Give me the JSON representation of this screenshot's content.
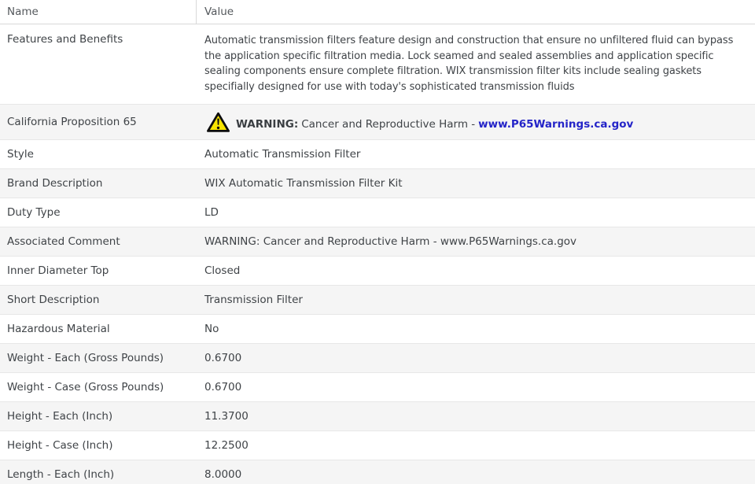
{
  "header": {
    "name_label": "Name",
    "value_label": "Value"
  },
  "prop65": {
    "icon": "warning-triangle-icon",
    "warning_label": "WARNING:",
    "text": "Cancer and Reproductive Harm -",
    "link_text": "www.P65Warnings.ca.gov"
  },
  "rows": [
    {
      "name": "Features and Benefits",
      "value": "Automatic transmission filters feature design and construction that ensure no unfiltered fluid can bypass the application specific filtration media. Lock seamed and sealed assemblies and application specific sealing components ensure complete filtration. WIX transmission filter kits include sealing gaskets specifially designed for use with today's sophisticated transmission fluids"
    },
    {
      "name": "California Proposition 65",
      "value": "WARNING: Cancer and Reproductive Harm - www.P65Warnings.ca.gov"
    },
    {
      "name": "Style",
      "value": "Automatic Transmission Filter"
    },
    {
      "name": "Brand Description",
      "value": "WIX Automatic Transmission Filter Kit"
    },
    {
      "name": "Duty Type",
      "value": "LD"
    },
    {
      "name": "Associated Comment",
      "value": "WARNING: Cancer and Reproductive Harm - www.P65Warnings.ca.gov"
    },
    {
      "name": "Inner Diameter Top",
      "value": "Closed"
    },
    {
      "name": "Short Description",
      "value": "Transmission Filter"
    },
    {
      "name": "Hazardous Material",
      "value": "No"
    },
    {
      "name": "Weight - Each (Gross Pounds)",
      "value": "0.6700"
    },
    {
      "name": "Weight - Case (Gross Pounds)",
      "value": "0.6700"
    },
    {
      "name": "Height - Each (Inch)",
      "value": "11.3700"
    },
    {
      "name": "Height - Case (Inch)",
      "value": "12.2500"
    },
    {
      "name": "Length - Each (Inch)",
      "value": "8.0000"
    }
  ],
  "colors": {
    "text": "#3f4347",
    "header_text": "#54585c",
    "link_blue": "#2424c8",
    "warning_yellow": "#f7e400",
    "row_alt_bg": "#f5f5f5",
    "border": "#e7e7e7",
    "header_border": "#d9d9d9"
  }
}
